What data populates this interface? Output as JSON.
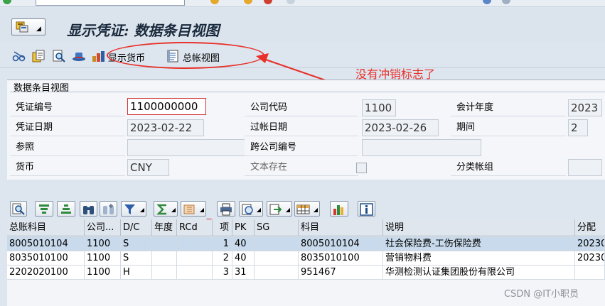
{
  "title": "显示凭证: 数据条目视图",
  "toolbar": {
    "display_currency": "显示货币",
    "general_ledger_view": "总帐视图"
  },
  "annotation": {
    "text": "没有冲销标志了",
    "color": "#e8312a"
  },
  "group": {
    "title": "数据条目视图",
    "fields": {
      "doc_no_label": "凭证编号",
      "doc_no": "1100000000",
      "company_code_label": "公司代码",
      "company_code": "1100",
      "fiscal_year_label": "会计年度",
      "fiscal_year": "2023",
      "doc_date_label": "凭证日期",
      "doc_date": "2023-02-22",
      "posting_date_label": "过帐日期",
      "posting_date": "2023-02-26",
      "period_label": "期间",
      "period": "2",
      "reference_label": "参照",
      "reference": "",
      "cross_company_label": "跨公司编号",
      "cross_company": "",
      "currency_label": "货币",
      "currency": "CNY",
      "text_exists_label": "文本存在",
      "ledger_group_label": "分类帐组",
      "ledger_group": ""
    }
  },
  "table": {
    "headers": [
      "总账科目",
      "公司...",
      "D/C",
      "年度",
      "RCd",
      "项",
      "PK",
      "SG",
      "科目",
      "说明",
      "分配"
    ],
    "rows": [
      [
        "8005010104",
        "1100",
        "S",
        "",
        "",
        "1",
        "40",
        "",
        "8005010104",
        "社会保险费-工伤保险费",
        "20230"
      ],
      [
        "8035010100",
        "1100",
        "S",
        "",
        "",
        "2",
        "40",
        "",
        "8035010100",
        "营销物料费",
        "20230"
      ],
      [
        "2202020100",
        "1100",
        "H",
        "",
        "",
        "3",
        "31",
        "",
        "951467",
        "华测检测认证集团股份有限公司",
        ""
      ]
    ]
  },
  "watermark": "CSDN @IT小职员"
}
